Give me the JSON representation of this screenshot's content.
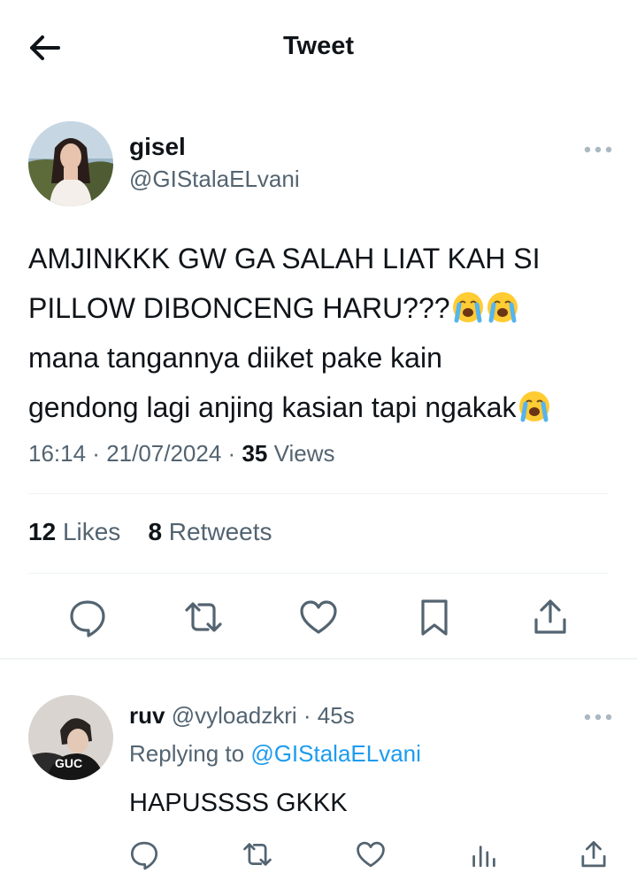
{
  "header": {
    "title": "Tweet",
    "back_icon": "arrow-left-icon"
  },
  "tweet": {
    "author": {
      "name": "gisel",
      "handle": "@GIStalaELvani"
    },
    "text_lines": [
      "AMJINKKK GW GA SALAH LIAT KAH SI",
      "PILLOW DIBONCENG HARU???",
      "mana tangannya diiket pake kain",
      "gendong lagi anjing kasian tapi ngakak"
    ],
    "emoji": "loudly-crying-face",
    "time": "16:14",
    "date": "21/07/2024",
    "views_count": "35",
    "views_label": "Views",
    "likes_count": "12",
    "likes_label": "Likes",
    "retweets_count": "8",
    "retweets_label": "Retweets"
  },
  "actions": [
    "reply-icon",
    "retweet-icon",
    "like-icon",
    "bookmark-icon",
    "share-icon"
  ],
  "reply": {
    "name": "ruv",
    "handle": "@vyloadzkri",
    "time": "45s",
    "replying_label": "Replying to",
    "replying_to": "@GIStalaELvani",
    "text": "HAPUSSSS GKKK",
    "actions": [
      "reply-icon",
      "retweet-icon",
      "like-icon",
      "analytics-icon",
      "share-icon"
    ]
  },
  "colors": {
    "text": "#0f1419",
    "secondary": "#536471",
    "link": "#1d9bf0",
    "divider": "#eff3f4"
  }
}
